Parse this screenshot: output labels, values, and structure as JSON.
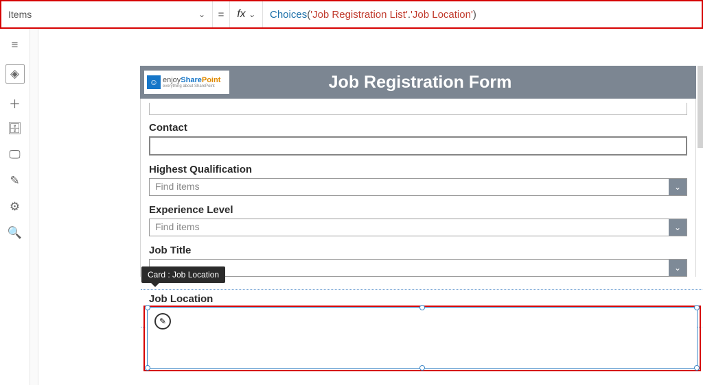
{
  "formulaBar": {
    "property": "Items",
    "fn": "Choices",
    "arg1": "'Job Registration List'",
    "arg2": "'Job Location'",
    "equals": "=",
    "fx": "fx"
  },
  "header": {
    "title": "Job Registration Form",
    "logo_top": "enjoySharePoint",
    "logo_sub": "everything about SharePoint"
  },
  "fields": {
    "contact": "Contact",
    "highestQual": "Highest Qualification",
    "expLevel": "Experience Level",
    "jobTitle": "Job Title",
    "jobLocation": "Job Location",
    "findItems": "Find items"
  },
  "tooltip": "Card : Job Location",
  "icons": {
    "hamburger": "≡",
    "layers": "◈",
    "plus": "＋",
    "data": "🗄",
    "media": "🖵",
    "tools": "✎",
    "settings": "⚙",
    "search": "🔍",
    "chevronDown": "⌄",
    "pencil": "✎"
  }
}
